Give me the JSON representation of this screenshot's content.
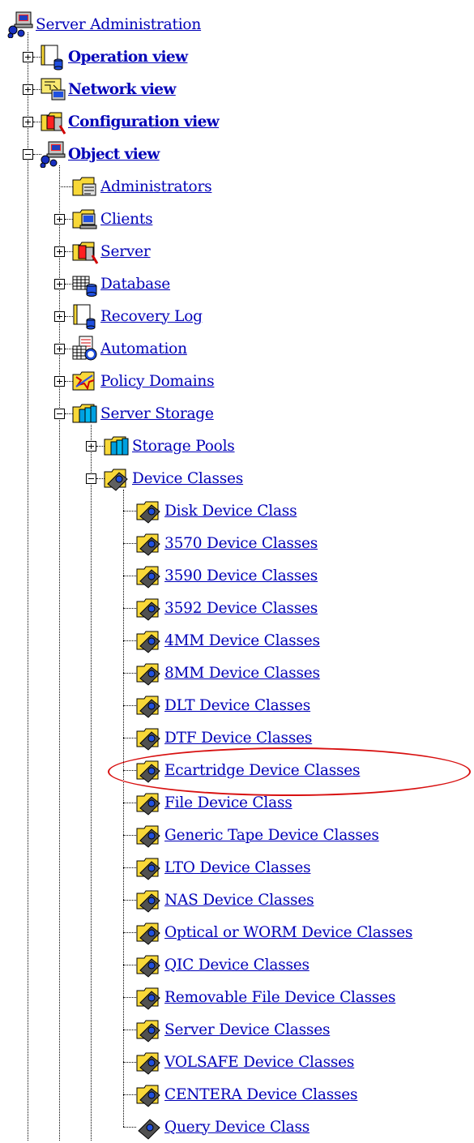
{
  "tree": {
    "root": {
      "label": "Server Administration",
      "icon": "server-admin-icon"
    },
    "views": [
      {
        "label": "Operation view",
        "icon": "operation-view-icon",
        "expanded": false
      },
      {
        "label": "Network view",
        "icon": "network-view-icon",
        "expanded": false
      },
      {
        "label": "Configuration view",
        "icon": "configuration-view-icon",
        "expanded": false
      },
      {
        "label": "Object view",
        "icon": "object-view-icon",
        "expanded": true
      }
    ],
    "object_items": [
      {
        "label": "Administrators",
        "icon": "administrators-folder-icon",
        "expandable": false
      },
      {
        "label": "Clients",
        "icon": "clients-folder-icon",
        "expandable": true
      },
      {
        "label": "Server",
        "icon": "server-folder-icon",
        "expandable": true
      },
      {
        "label": "Database",
        "icon": "database-icon",
        "expandable": true
      },
      {
        "label": "Recovery Log",
        "icon": "recovery-log-icon",
        "expandable": true
      },
      {
        "label": "Automation",
        "icon": "automation-icon",
        "expandable": true
      },
      {
        "label": "Policy Domains",
        "icon": "policy-domains-icon",
        "expandable": true
      },
      {
        "label": "Server Storage",
        "icon": "server-storage-icon",
        "expandable": true,
        "expanded": true
      }
    ],
    "storage_items": [
      {
        "label": "Storage Pools",
        "icon": "storage-pools-icon",
        "expanded": false
      },
      {
        "label": "Device Classes",
        "icon": "device-classes-icon",
        "expanded": true
      }
    ],
    "device_classes": [
      "Disk Device Class",
      "3570 Device Classes",
      "3590 Device Classes",
      "3592 Device Classes",
      "4MM Device Classes",
      "8MM Device Classes",
      "DLT Device Classes",
      "DTF Device Classes",
      "Ecartridge Device Classes",
      "File Device Class",
      "Generic Tape Device Classes",
      "LTO Device Classes",
      "NAS Device Classes",
      "Optical or WORM Device Classes",
      "QIC Device Classes",
      "Removable File Device Classes",
      "Server Device Classes",
      "VOLSAFE Device Classes",
      "CENTERA Device Classes",
      "Query Device Class"
    ],
    "highlighted_item": "Ecartridge Device Classes",
    "colors": {
      "link": "#0000b8",
      "highlight_ring": "#d81010",
      "folder": "#f8d838"
    }
  }
}
